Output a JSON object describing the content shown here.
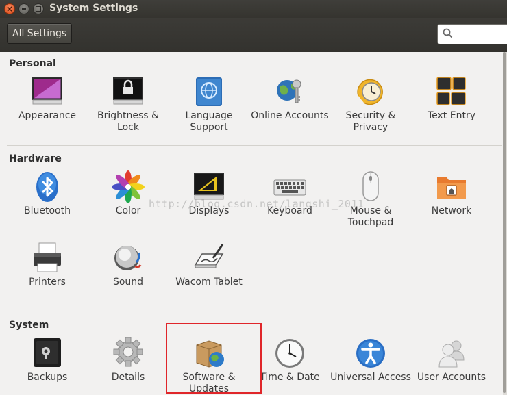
{
  "window": {
    "title": "System Settings"
  },
  "toolbar": {
    "all_settings_label": "All Settings",
    "search_placeholder": ""
  },
  "sections": {
    "personal": {
      "title": "Personal",
      "items": [
        {
          "label": "Appearance",
          "icon": "appearance-icon"
        },
        {
          "label": "Brightness & Lock",
          "icon": "brightness-lock-icon"
        },
        {
          "label": "Language Support",
          "icon": "language-support-icon"
        },
        {
          "label": "Online Accounts",
          "icon": "online-accounts-icon"
        },
        {
          "label": "Security & Privacy",
          "icon": "security-privacy-icon"
        },
        {
          "label": "Text Entry",
          "icon": "text-entry-icon"
        }
      ]
    },
    "hardware": {
      "title": "Hardware",
      "items": [
        {
          "label": "Bluetooth",
          "icon": "bluetooth-icon"
        },
        {
          "label": "Color",
          "icon": "color-icon"
        },
        {
          "label": "Displays",
          "icon": "displays-icon"
        },
        {
          "label": "Keyboard",
          "icon": "keyboard-icon"
        },
        {
          "label": "Mouse & Touchpad",
          "icon": "mouse-touchpad-icon"
        },
        {
          "label": "Network",
          "icon": "network-icon"
        },
        {
          "label": "Printers",
          "icon": "printer-icon"
        },
        {
          "label": "Sound",
          "icon": "sound-icon"
        },
        {
          "label": "Wacom Tablet",
          "icon": "wacom-tablet-icon"
        }
      ]
    },
    "system": {
      "title": "System",
      "items": [
        {
          "label": "Backups",
          "icon": "backups-icon"
        },
        {
          "label": "Details",
          "icon": "details-icon"
        },
        {
          "label": "Software & Updates",
          "icon": "software-updates-icon"
        },
        {
          "label": "Time & Date",
          "icon": "time-date-icon"
        },
        {
          "label": "Universal Access",
          "icon": "universal-access-icon"
        },
        {
          "label": "User Accounts",
          "icon": "user-accounts-icon"
        }
      ]
    }
  },
  "watermark": "http://blog.csdn.net/langshi_2011",
  "colors": {
    "highlight_box": "#e0262a",
    "titlebar": "#3c3b37",
    "close_button": "#e5541d"
  }
}
